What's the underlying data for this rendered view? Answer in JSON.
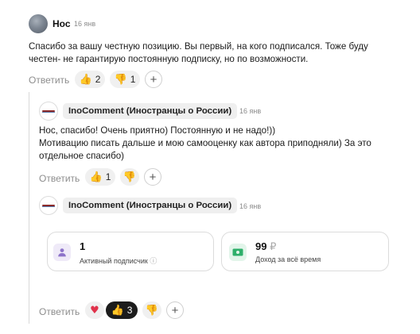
{
  "comment": {
    "author": "Нос",
    "date": "16 янв",
    "text_line1": "Спасибо за вашу честную позицию. Вы первый, на кого подписался. Тоже буду",
    "text_line2": "честен- не гарантирую постоянную подписку, но по возможности.",
    "reply_label": "Ответить",
    "likes": "2",
    "dislikes": "1",
    "like_icon": "thumbs-up-emoji",
    "dislike_icon": "thumbs-down-emoji"
  },
  "reply1": {
    "author": "InoComment (Иностранцы о России)",
    "date": "16 янв",
    "text_line1": "Нос, спасибо! Очень приятно) Постоянную и не надо!))",
    "text_line2": "Мотивацию писать дальше и мою самооценку как автора приподняли) За это",
    "text_line3": "отдельное спасибо)",
    "reply_label": "Ответить",
    "likes": "1"
  },
  "reply2": {
    "author": "InoComment (Иностранцы о России)",
    "date": "16 янв",
    "card_subscribers": {
      "value": "1",
      "label": "Активный подписчик",
      "info_glyph": "ⓘ",
      "icon": "person-icon"
    },
    "card_income": {
      "value": "99",
      "currency": "₽",
      "label": "Доход за всё время",
      "icon": "money-icon"
    },
    "reply_label": "Ответить",
    "likes": "3"
  },
  "colors": {
    "accent_green": "#2eaf6a",
    "person_purple": "#8d73c9",
    "thread_line": "#d9d9d9"
  }
}
